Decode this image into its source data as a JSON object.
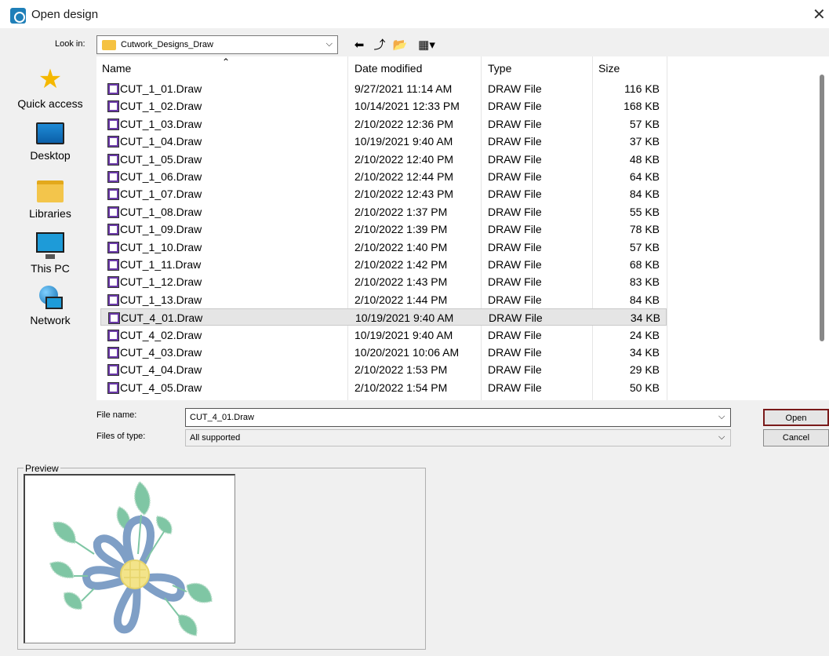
{
  "window": {
    "title": "Open design"
  },
  "lookin": {
    "label": "Look in:",
    "folder": "Cutwork_Designs_Draw"
  },
  "places": [
    {
      "label": "Quick access",
      "icon": "star-icon"
    },
    {
      "label": "Desktop",
      "icon": "desktop-icon"
    },
    {
      "label": "Libraries",
      "icon": "libraries-icon"
    },
    {
      "label": "This PC",
      "icon": "this-pc-icon"
    },
    {
      "label": "Network",
      "icon": "network-icon"
    }
  ],
  "columns": {
    "name": "Name",
    "date": "Date modified",
    "type": "Type",
    "size": "Size"
  },
  "files": [
    {
      "name": "CUT_1_01.Draw",
      "date": "9/27/2021 11:14 AM",
      "type": "DRAW File",
      "size": "116 KB"
    },
    {
      "name": "CUT_1_02.Draw",
      "date": "10/14/2021 12:33 PM",
      "type": "DRAW File",
      "size": "168 KB"
    },
    {
      "name": "CUT_1_03.Draw",
      "date": "2/10/2022 12:36 PM",
      "type": "DRAW File",
      "size": "57 KB"
    },
    {
      "name": "CUT_1_04.Draw",
      "date": "10/19/2021 9:40 AM",
      "type": "DRAW File",
      "size": "37 KB"
    },
    {
      "name": "CUT_1_05.Draw",
      "date": "2/10/2022 12:40 PM",
      "type": "DRAW File",
      "size": "48 KB"
    },
    {
      "name": "CUT_1_06.Draw",
      "date": "2/10/2022 12:44 PM",
      "type": "DRAW File",
      "size": "64 KB"
    },
    {
      "name": "CUT_1_07.Draw",
      "date": "2/10/2022 12:43 PM",
      "type": "DRAW File",
      "size": "84 KB"
    },
    {
      "name": "CUT_1_08.Draw",
      "date": "2/10/2022 1:37 PM",
      "type": "DRAW File",
      "size": "55 KB"
    },
    {
      "name": "CUT_1_09.Draw",
      "date": "2/10/2022 1:39 PM",
      "type": "DRAW File",
      "size": "78 KB"
    },
    {
      "name": "CUT_1_10.Draw",
      "date": "2/10/2022 1:40 PM",
      "type": "DRAW File",
      "size": "57 KB"
    },
    {
      "name": "CUT_1_11.Draw",
      "date": "2/10/2022 1:42 PM",
      "type": "DRAW File",
      "size": "68 KB"
    },
    {
      "name": "CUT_1_12.Draw",
      "date": "2/10/2022 1:43 PM",
      "type": "DRAW File",
      "size": "83 KB"
    },
    {
      "name": "CUT_1_13.Draw",
      "date": "2/10/2022 1:44 PM",
      "type": "DRAW File",
      "size": "84 KB"
    },
    {
      "name": "CUT_4_01.Draw",
      "date": "10/19/2021 9:40 AM",
      "type": "DRAW File",
      "size": "34 KB",
      "selected": true
    },
    {
      "name": "CUT_4_02.Draw",
      "date": "10/19/2021 9:40 AM",
      "type": "DRAW File",
      "size": "24 KB"
    },
    {
      "name": "CUT_4_03.Draw",
      "date": "10/20/2021 10:06 AM",
      "type": "DRAW File",
      "size": "34 KB"
    },
    {
      "name": "CUT_4_04.Draw",
      "date": "2/10/2022 1:53 PM",
      "type": "DRAW File",
      "size": "29 KB"
    },
    {
      "name": "CUT_4_05.Draw",
      "date": "2/10/2022 1:54 PM",
      "type": "DRAW File",
      "size": "50 KB"
    }
  ],
  "filename": {
    "label": "File name:",
    "value": "CUT_4_01.Draw"
  },
  "filetype": {
    "label": "Files of type:",
    "value": "All supported"
  },
  "buttons": {
    "open": "Open",
    "cancel": "Cancel"
  },
  "preview": {
    "label": "Preview"
  },
  "colors": {
    "selected_row": "#e5e5e5",
    "open_border": "#7a1a1a",
    "leaf": "#7fc6a4",
    "petal": "#8fa8c8",
    "center": "#f3e48a"
  }
}
